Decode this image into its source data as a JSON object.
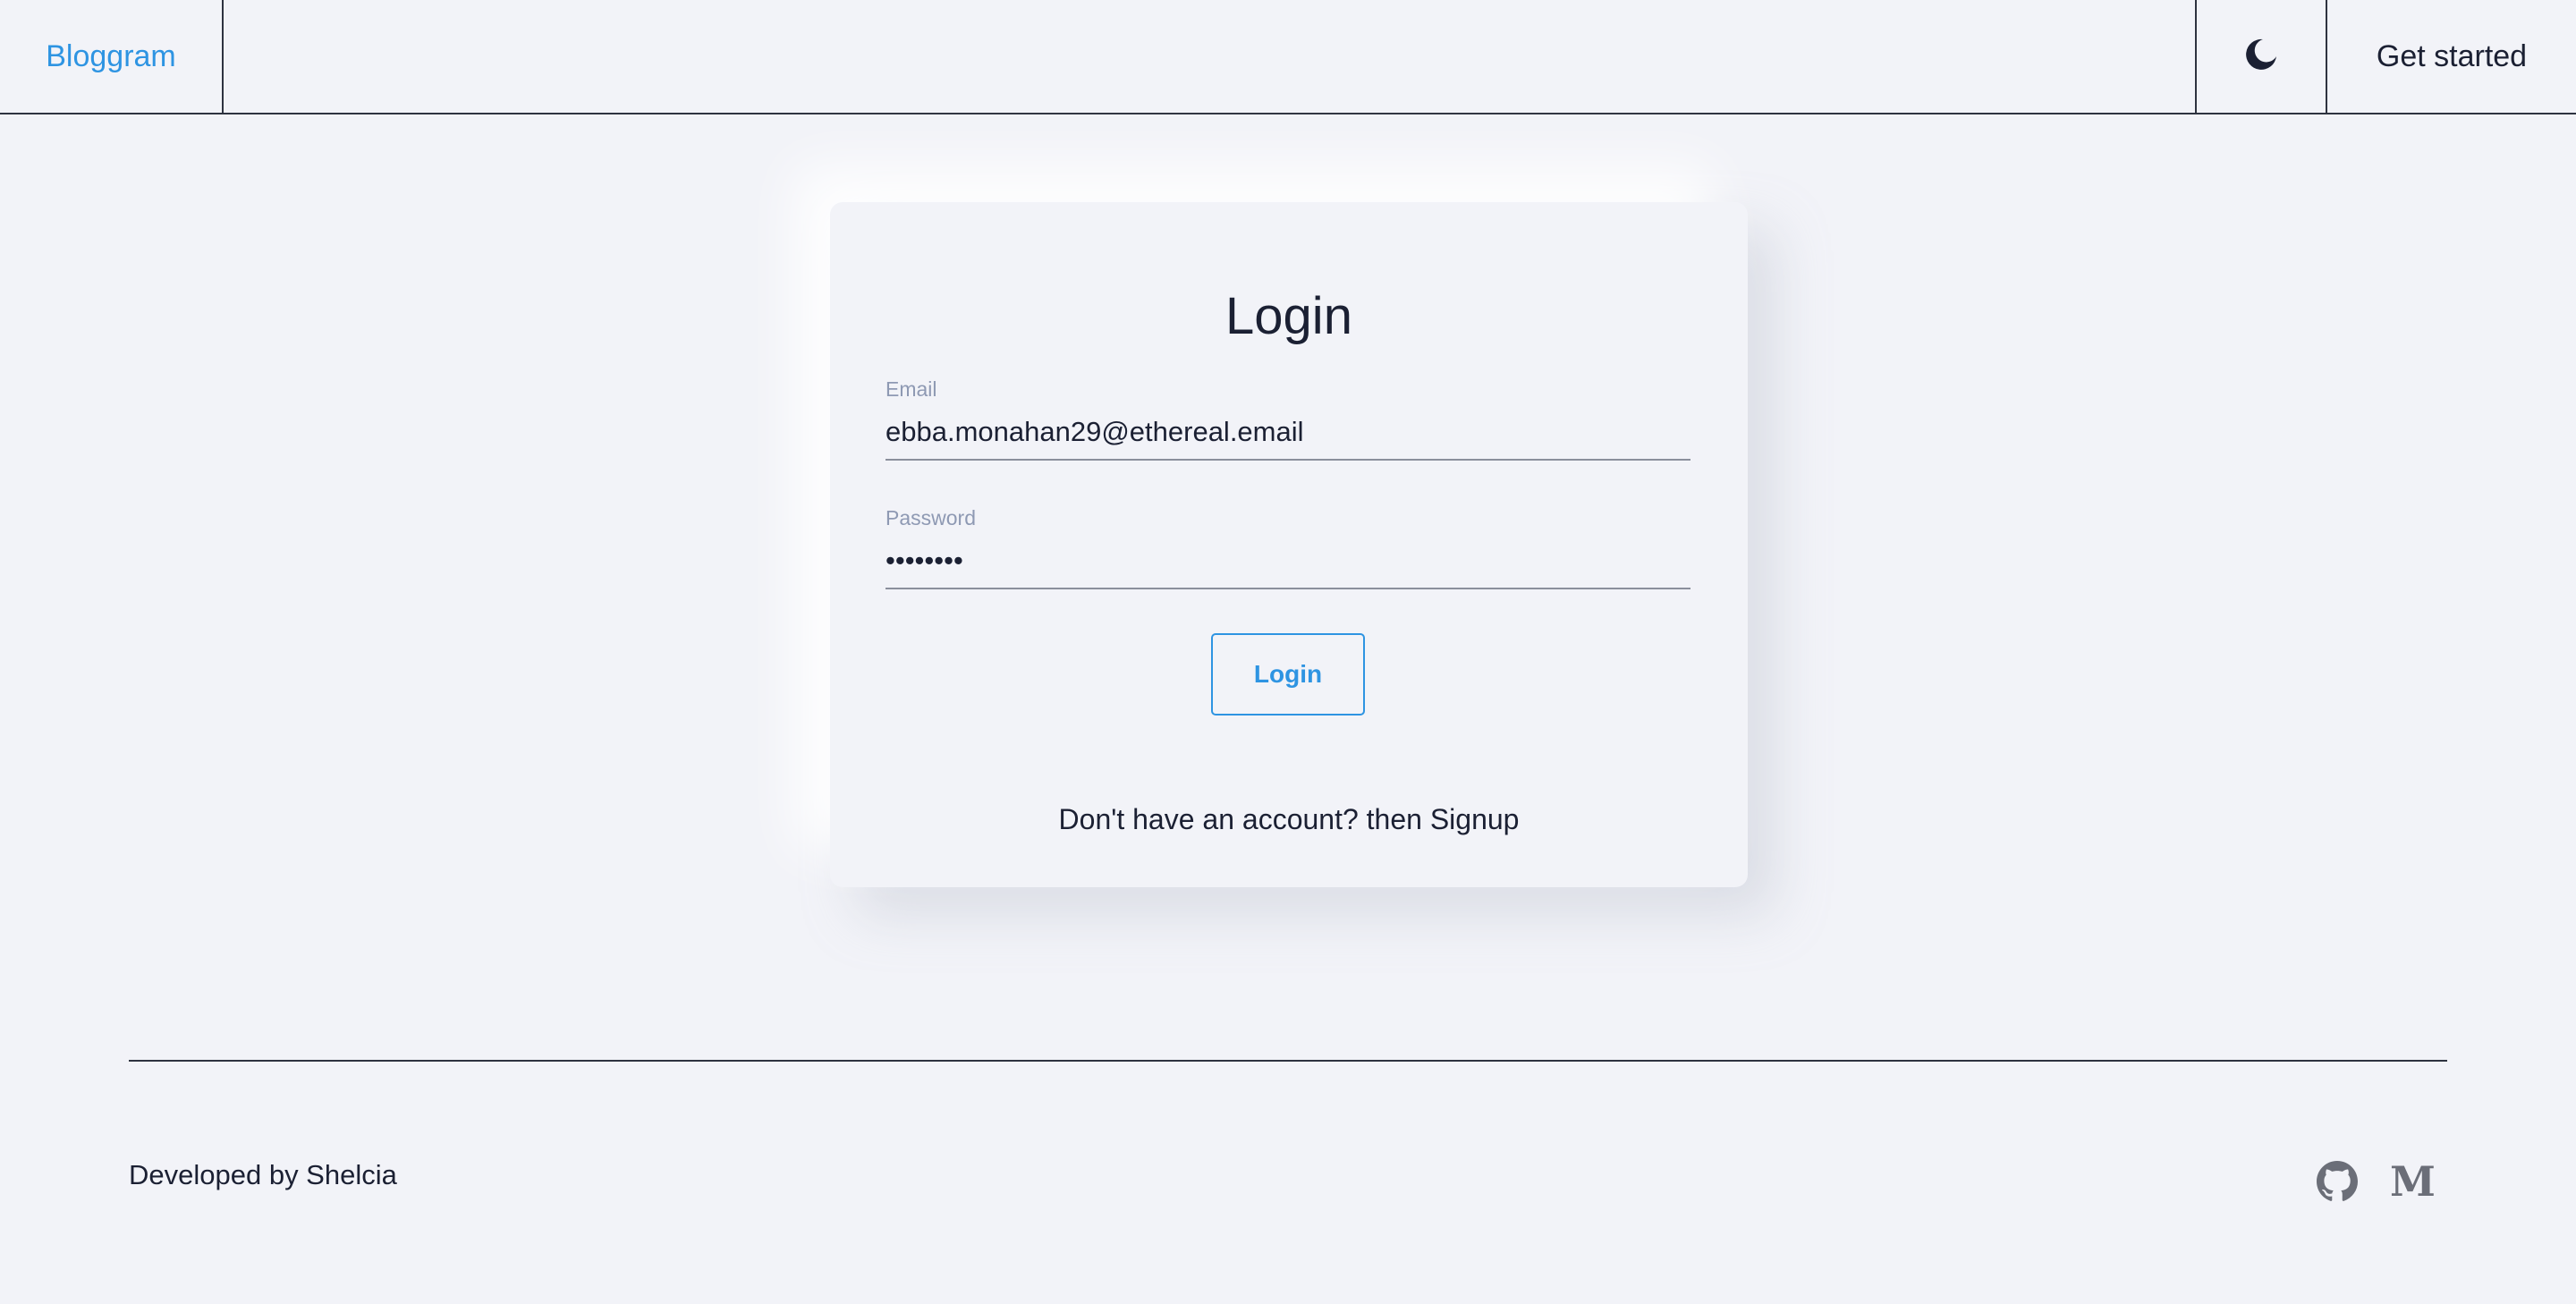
{
  "navbar": {
    "brand": "Bloggram",
    "theme_toggle_icon": "moon-icon",
    "get_started_label": "Get started"
  },
  "login": {
    "title": "Login",
    "email_label": "Email",
    "email_value": "ebba.monahan29@ethereal.email",
    "password_label": "Password",
    "password_value": "••••••••",
    "submit_label": "Login",
    "signup_prompt": "Don't have an account? then ",
    "signup_link": "Signup"
  },
  "footer": {
    "credit": "Developed by Shelcia",
    "icons": [
      "github-icon",
      "medium-icon"
    ],
    "medium_glyph": "M"
  },
  "colors": {
    "background": "#f2f3f8",
    "accent": "#2e94e2",
    "text": "#1b2033",
    "label": "#8e99b3"
  }
}
